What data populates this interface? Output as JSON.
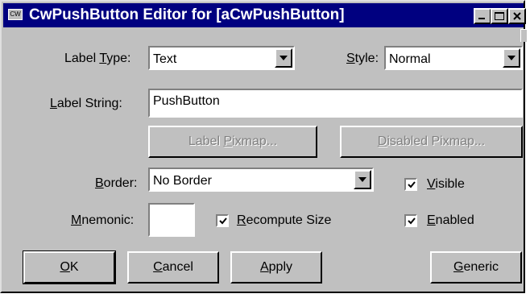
{
  "window": {
    "title": "CwPushButton Editor for [aCwPushButton]",
    "system_icon_text": "CW"
  },
  "form": {
    "label_type": {
      "label_pre": "Label ",
      "label_key": "T",
      "label_post": "ype:",
      "value": "Text"
    },
    "style": {
      "label_key": "S",
      "label_post": "tyle:",
      "value": "Normal"
    },
    "label_string": {
      "label_key": "L",
      "label_post": "abel String:",
      "value": "PushButton"
    },
    "border": {
      "label_key": "B",
      "label_post": "order:",
      "value": "No Border"
    },
    "mnemonic": {
      "label_key": "M",
      "label_post": "nemonic:",
      "value": ""
    }
  },
  "buttons": {
    "label_pixmap": {
      "pre": "Label ",
      "key": "P",
      "post": "ixmap..."
    },
    "disabled_pixmap": {
      "pre": "",
      "key": "D",
      "post": "isabled Pixmap..."
    },
    "ok": {
      "pre": "",
      "key": "O",
      "post": "K"
    },
    "cancel": {
      "pre": "",
      "key": "C",
      "post": "ancel"
    },
    "apply": {
      "pre": "",
      "key": "A",
      "post": "pply"
    },
    "generic": {
      "pre": "",
      "key": "G",
      "post": "eneric"
    }
  },
  "checkboxes": {
    "visible": {
      "key": "V",
      "post": "isible",
      "checked": true
    },
    "enabled": {
      "key": "E",
      "post": "nabled",
      "checked": true
    },
    "recompute_size": {
      "key": "R",
      "post": "ecompute Size",
      "checked": true
    }
  }
}
